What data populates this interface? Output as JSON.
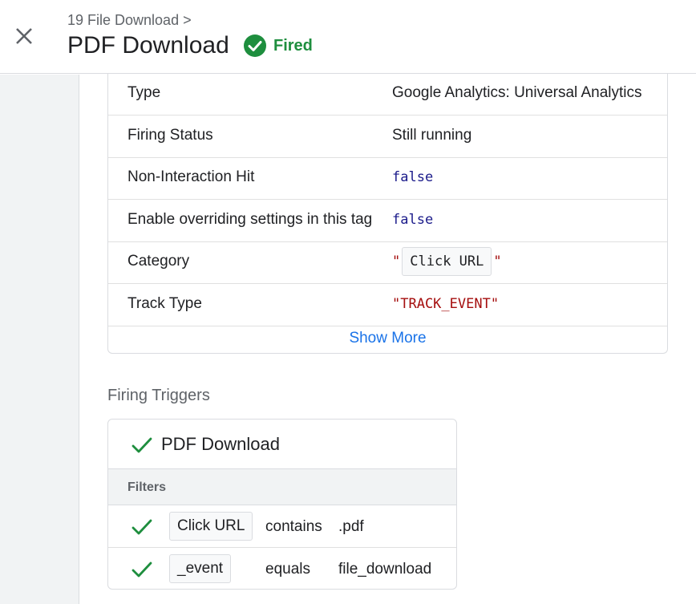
{
  "header": {
    "breadcrumb": "19 File Download >",
    "title": "PDF Download",
    "status_label": "Fired",
    "status_color": "#1e8e3e"
  },
  "icons": {
    "close": "close-icon",
    "fired": "check-circle-icon",
    "trigger_check": "checkmark-icon"
  },
  "properties": {
    "rows": [
      {
        "key": "Type",
        "value": "Google Analytics: Universal Analytics"
      },
      {
        "key": "Firing Status",
        "value": "Still running"
      },
      {
        "key": "Non-Interaction Hit",
        "value": "false"
      },
      {
        "key": "Enable overriding settings in this tag",
        "value": "false"
      },
      {
        "key": "Category",
        "value": "Click URL",
        "quote_open": "\"",
        "quote_close": "\""
      },
      {
        "key": "Track Type",
        "value": "\"TRACK_EVENT\""
      }
    ],
    "show_more": "Show More"
  },
  "triggers": {
    "section_title": "Firing Triggers",
    "name": "PDF Download",
    "filters_label": "Filters",
    "filters": [
      {
        "variable": "Click URL",
        "operator": "contains",
        "value": ".pdf"
      },
      {
        "variable": "_event",
        "operator": "equals",
        "value": "file_download"
      }
    ]
  },
  "colors": {
    "accent_link": "#1a73e8",
    "success": "#1e8e3e",
    "boolean_value": "#1a1a8a",
    "string_value": "#a50e0e"
  }
}
